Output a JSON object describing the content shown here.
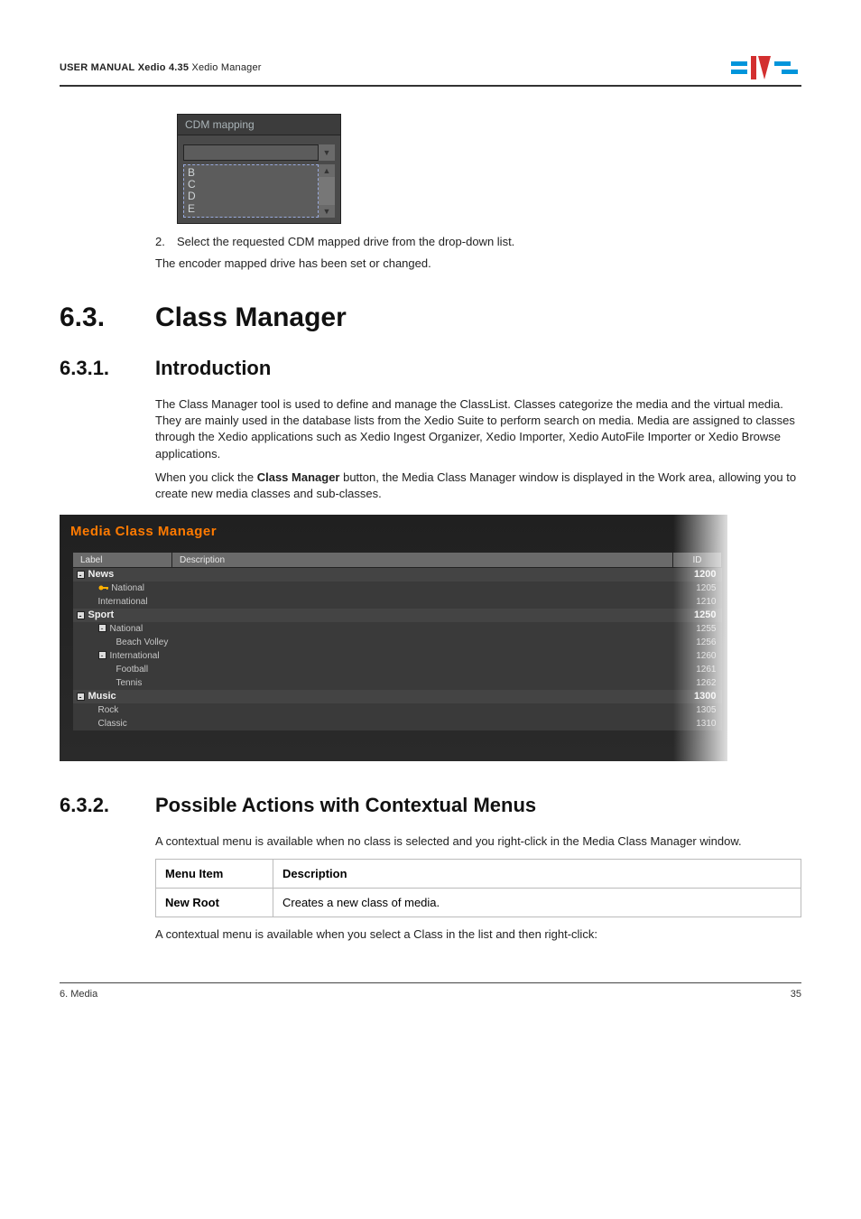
{
  "header": {
    "manual": "USER MANUAL",
    "product": "Xedio 4.35",
    "module": "Xedio Manager"
  },
  "cdm": {
    "tab": "CDM mapping",
    "items": [
      "B",
      "C",
      "D",
      "E"
    ]
  },
  "step": {
    "num": "2.",
    "text": "Select the requested CDM mapped drive from the drop-down list."
  },
  "followup": "The encoder mapped drive has been set or changed.",
  "s63": {
    "num": "6.3.",
    "title": "Class Manager"
  },
  "s631": {
    "num": "6.3.1.",
    "title": "Introduction"
  },
  "intro_p1": "The Class Manager tool is used to define and manage the ClassList. Classes categorize the media and the virtual media. They are mainly used in the database lists from the Xedio Suite to perform search on media. Media are assigned to classes through the Xedio applications such as Xedio Ingest Organizer, Xedio Importer, Xedio AutoFile Importer or Xedio Browse applications.",
  "intro_p2a": "When you click the ",
  "intro_p2b": "Class Manager",
  "intro_p2c": " button, the Media Class Manager window is displayed in the Work area, allowing you to create new media classes and sub-classes.",
  "mcm": {
    "title": "Media Class Manager",
    "cols": {
      "label": "Label",
      "desc": "Description",
      "id": "ID"
    },
    "rows": [
      {
        "level": "top",
        "toggle": "-",
        "label": "News",
        "id": "1200",
        "icon": false
      },
      {
        "level": "child",
        "indent": 1,
        "label": "National",
        "id": "1205",
        "icon": true
      },
      {
        "level": "child",
        "indent": 1,
        "label": "International",
        "id": "1210"
      },
      {
        "level": "top",
        "toggle": "-",
        "label": "Sport",
        "id": "1250"
      },
      {
        "level": "child",
        "indent": 1,
        "toggle": "-",
        "label": "National",
        "id": "1255"
      },
      {
        "level": "child",
        "indent": 2,
        "label": "Beach Volley",
        "id": "1256"
      },
      {
        "level": "child",
        "indent": 1,
        "toggle": "-",
        "label": "International",
        "id": "1260"
      },
      {
        "level": "child",
        "indent": 2,
        "label": "Football",
        "id": "1261"
      },
      {
        "level": "child",
        "indent": 2,
        "label": "Tennis",
        "id": "1262"
      },
      {
        "level": "top",
        "toggle": "-",
        "label": "Music",
        "id": "1300"
      },
      {
        "level": "child",
        "indent": 1,
        "label": "Rock",
        "id": "1305"
      },
      {
        "level": "child",
        "indent": 1,
        "label": "Classic",
        "id": "1310"
      }
    ]
  },
  "s632": {
    "num": "6.3.2.",
    "title": "Possible Actions with Contextual Menus"
  },
  "ctx_p1": "A contextual menu is available when no class is selected and you right-click in the Media Class Manager window.",
  "menu": {
    "h1": "Menu Item",
    "h2": "Description",
    "r1c1": "New Root",
    "r1c2": "Creates a new class of media."
  },
  "ctx_p2": "A contextual menu is available when you select a Class in the list and then right-click:",
  "footer": {
    "left": "6. Media",
    "right": "35"
  }
}
